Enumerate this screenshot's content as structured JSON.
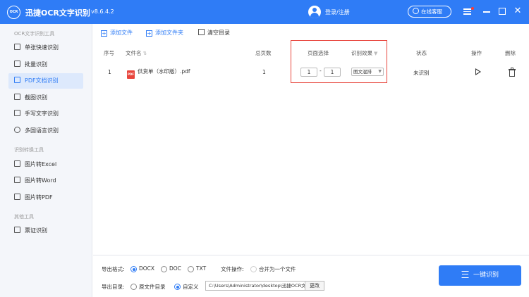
{
  "app": {
    "logo_text": "OCR",
    "title": "迅捷OCR文字识别",
    "version": "v8.6.4.2",
    "login_label": "登录/注册",
    "service_label": "在线客服"
  },
  "sidebar": {
    "section1_title": "OCR文字识别工具",
    "section1_items": [
      {
        "label": "单张快速识别"
      },
      {
        "label": "批量识别"
      },
      {
        "label": "PDF文档识别"
      },
      {
        "label": "截图识别"
      },
      {
        "label": "手写文字识别"
      },
      {
        "label": "多国语言识别"
      }
    ],
    "section2_title": "识别转换工具",
    "section2_items": [
      {
        "label": "图片转Excel"
      },
      {
        "label": "图片转Word"
      },
      {
        "label": "图片转PDF"
      }
    ],
    "section3_title": "其他工具",
    "section3_items": [
      {
        "label": "票证识别"
      }
    ]
  },
  "toolbar": {
    "add_file": "添加文件",
    "add_folder": "添加文件夹",
    "clear": "清空目录"
  },
  "table": {
    "headers": {
      "index": "序号",
      "filename": "文件名",
      "total_pages": "总页数",
      "page_select": "页面选择",
      "effect": "识别效果",
      "status": "状态",
      "action": "操作",
      "delete": "删除"
    },
    "rows": [
      {
        "index": "1",
        "filename": "供货单（水印版）.pdf",
        "total_pages": "1",
        "page_from": "1",
        "page_sep": "-",
        "page_to": "1",
        "effect": "图文混排",
        "status": "未识别"
      }
    ]
  },
  "bottom": {
    "format_label": "导出格式:",
    "formats": [
      "DOCX",
      "DOC",
      "TXT"
    ],
    "selected_format": "DOCX",
    "file_op_label": "文件操作:",
    "merge_label": "合并为一个文件",
    "dir_label": "导出目录:",
    "dir_option_original": "原文件目录",
    "dir_option_custom": "自定义",
    "path_value": "C:\\Users\\Administrator\\desktop\\迅捷OCR文",
    "change_label": "更改",
    "ocr_button": "一键识别"
  },
  "colors": {
    "accent": "#2f7cf6",
    "highlight_box": "#e8453c"
  }
}
